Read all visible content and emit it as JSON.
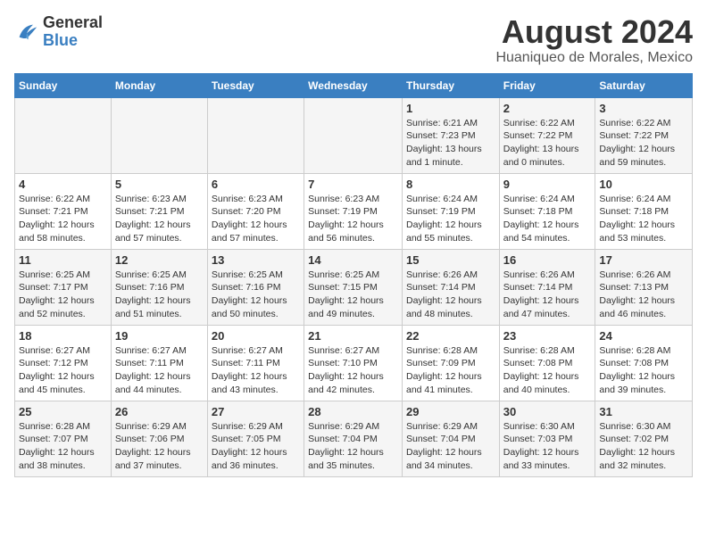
{
  "logo": {
    "general": "General",
    "blue": "Blue"
  },
  "title": "August 2024",
  "location": "Huaniqueo de Morales, Mexico",
  "days_header": [
    "Sunday",
    "Monday",
    "Tuesday",
    "Wednesday",
    "Thursday",
    "Friday",
    "Saturday"
  ],
  "weeks": [
    [
      {
        "day": "",
        "info": ""
      },
      {
        "day": "",
        "info": ""
      },
      {
        "day": "",
        "info": ""
      },
      {
        "day": "",
        "info": ""
      },
      {
        "day": "1",
        "info": "Sunrise: 6:21 AM\nSunset: 7:23 PM\nDaylight: 13 hours\nand 1 minute."
      },
      {
        "day": "2",
        "info": "Sunrise: 6:22 AM\nSunset: 7:22 PM\nDaylight: 13 hours\nand 0 minutes."
      },
      {
        "day": "3",
        "info": "Sunrise: 6:22 AM\nSunset: 7:22 PM\nDaylight: 12 hours\nand 59 minutes."
      }
    ],
    [
      {
        "day": "4",
        "info": "Sunrise: 6:22 AM\nSunset: 7:21 PM\nDaylight: 12 hours\nand 58 minutes."
      },
      {
        "day": "5",
        "info": "Sunrise: 6:23 AM\nSunset: 7:21 PM\nDaylight: 12 hours\nand 57 minutes."
      },
      {
        "day": "6",
        "info": "Sunrise: 6:23 AM\nSunset: 7:20 PM\nDaylight: 12 hours\nand 57 minutes."
      },
      {
        "day": "7",
        "info": "Sunrise: 6:23 AM\nSunset: 7:19 PM\nDaylight: 12 hours\nand 56 minutes."
      },
      {
        "day": "8",
        "info": "Sunrise: 6:24 AM\nSunset: 7:19 PM\nDaylight: 12 hours\nand 55 minutes."
      },
      {
        "day": "9",
        "info": "Sunrise: 6:24 AM\nSunset: 7:18 PM\nDaylight: 12 hours\nand 54 minutes."
      },
      {
        "day": "10",
        "info": "Sunrise: 6:24 AM\nSunset: 7:18 PM\nDaylight: 12 hours\nand 53 minutes."
      }
    ],
    [
      {
        "day": "11",
        "info": "Sunrise: 6:25 AM\nSunset: 7:17 PM\nDaylight: 12 hours\nand 52 minutes."
      },
      {
        "day": "12",
        "info": "Sunrise: 6:25 AM\nSunset: 7:16 PM\nDaylight: 12 hours\nand 51 minutes."
      },
      {
        "day": "13",
        "info": "Sunrise: 6:25 AM\nSunset: 7:16 PM\nDaylight: 12 hours\nand 50 minutes."
      },
      {
        "day": "14",
        "info": "Sunrise: 6:25 AM\nSunset: 7:15 PM\nDaylight: 12 hours\nand 49 minutes."
      },
      {
        "day": "15",
        "info": "Sunrise: 6:26 AM\nSunset: 7:14 PM\nDaylight: 12 hours\nand 48 minutes."
      },
      {
        "day": "16",
        "info": "Sunrise: 6:26 AM\nSunset: 7:14 PM\nDaylight: 12 hours\nand 47 minutes."
      },
      {
        "day": "17",
        "info": "Sunrise: 6:26 AM\nSunset: 7:13 PM\nDaylight: 12 hours\nand 46 minutes."
      }
    ],
    [
      {
        "day": "18",
        "info": "Sunrise: 6:27 AM\nSunset: 7:12 PM\nDaylight: 12 hours\nand 45 minutes."
      },
      {
        "day": "19",
        "info": "Sunrise: 6:27 AM\nSunset: 7:11 PM\nDaylight: 12 hours\nand 44 minutes."
      },
      {
        "day": "20",
        "info": "Sunrise: 6:27 AM\nSunset: 7:11 PM\nDaylight: 12 hours\nand 43 minutes."
      },
      {
        "day": "21",
        "info": "Sunrise: 6:27 AM\nSunset: 7:10 PM\nDaylight: 12 hours\nand 42 minutes."
      },
      {
        "day": "22",
        "info": "Sunrise: 6:28 AM\nSunset: 7:09 PM\nDaylight: 12 hours\nand 41 minutes."
      },
      {
        "day": "23",
        "info": "Sunrise: 6:28 AM\nSunset: 7:08 PM\nDaylight: 12 hours\nand 40 minutes."
      },
      {
        "day": "24",
        "info": "Sunrise: 6:28 AM\nSunset: 7:08 PM\nDaylight: 12 hours\nand 39 minutes."
      }
    ],
    [
      {
        "day": "25",
        "info": "Sunrise: 6:28 AM\nSunset: 7:07 PM\nDaylight: 12 hours\nand 38 minutes."
      },
      {
        "day": "26",
        "info": "Sunrise: 6:29 AM\nSunset: 7:06 PM\nDaylight: 12 hours\nand 37 minutes."
      },
      {
        "day": "27",
        "info": "Sunrise: 6:29 AM\nSunset: 7:05 PM\nDaylight: 12 hours\nand 36 minutes."
      },
      {
        "day": "28",
        "info": "Sunrise: 6:29 AM\nSunset: 7:04 PM\nDaylight: 12 hours\nand 35 minutes."
      },
      {
        "day": "29",
        "info": "Sunrise: 6:29 AM\nSunset: 7:04 PM\nDaylight: 12 hours\nand 34 minutes."
      },
      {
        "day": "30",
        "info": "Sunrise: 6:30 AM\nSunset: 7:03 PM\nDaylight: 12 hours\nand 33 minutes."
      },
      {
        "day": "31",
        "info": "Sunrise: 6:30 AM\nSunset: 7:02 PM\nDaylight: 12 hours\nand 32 minutes."
      }
    ]
  ]
}
